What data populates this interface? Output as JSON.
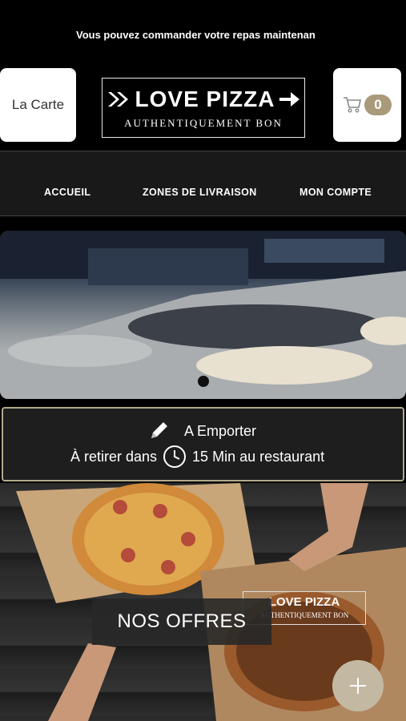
{
  "header": {
    "announcement": "Vous pouvez commander votre repas maintenan",
    "menu_button": "La Carte",
    "cart_count": "0",
    "cart_icon": "cart-icon"
  },
  "logo": {
    "title": "LOVE PIZZA",
    "subtitle": "AUTHENTIQUEMENT BON"
  },
  "nav": {
    "items": [
      "ACCUEIL",
      "ZONES DE LIVRAISON",
      "MON COMPTE"
    ]
  },
  "order_mode": {
    "mode": "A Emporter",
    "pickup_prefix": "À retirer dans",
    "pickup_suffix": "15 Min au restaurant",
    "icons": [
      "pencil-icon",
      "clock-icon"
    ]
  },
  "offers": {
    "label": "NOS OFFRES",
    "logo_title": "LOVE PIZZA",
    "logo_subtitle": "AUTHENTIQUEMENT BON"
  },
  "colors": {
    "accent": "#a89a7a",
    "fab": "#c3b9a3",
    "border_gold": "#b3aa8c"
  }
}
